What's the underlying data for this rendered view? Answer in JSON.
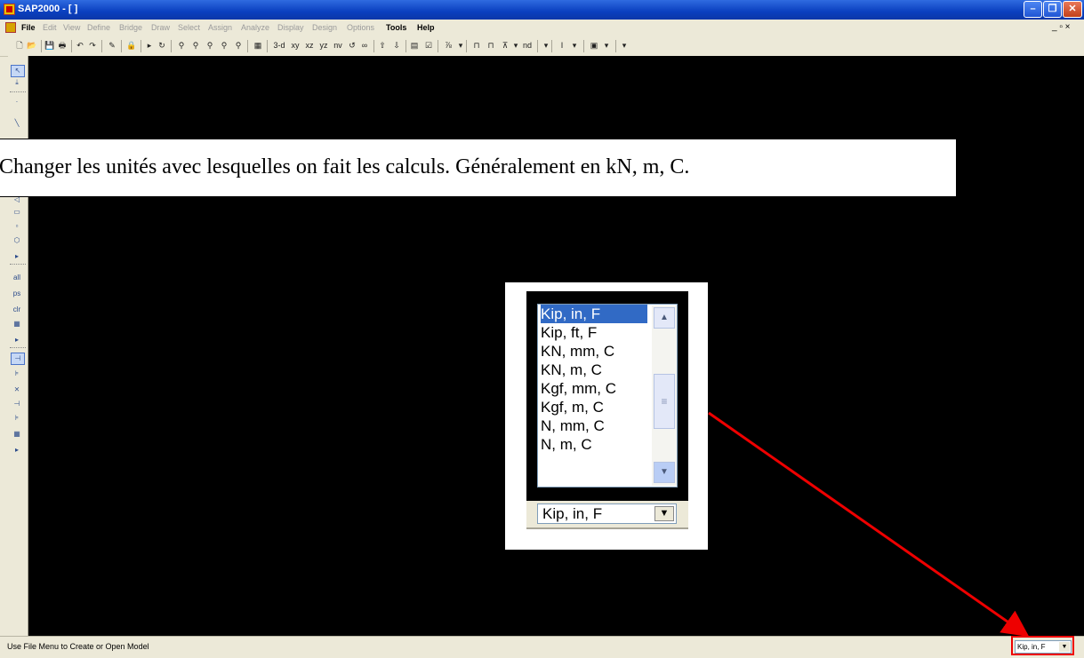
{
  "window": {
    "title": "SAP2000 - [ ]"
  },
  "menu": {
    "items": [
      "File",
      "Edit",
      "View",
      "Define",
      "Bridge",
      "Draw",
      "Select",
      "Assign",
      "Analyze",
      "Display",
      "Design",
      "Options",
      "Tools",
      "Help"
    ],
    "mdi_controls": "_ Ὕ7 ×"
  },
  "toolbar": {
    "view_3d": "3-d",
    "view_xy": "xy",
    "view_xz": "xz",
    "view_yz": "yz",
    "view_nv": "nv",
    "nd": "nd"
  },
  "left_toolbar": {
    "labels": [
      "all",
      "ps",
      "clr"
    ]
  },
  "callout": {
    "text": "Changer les unités avec lesquelles on fait les calculs. Généralement  en kN, m, C."
  },
  "units_dropdown": {
    "options": [
      "Kip, in, F",
      "Kip, ft, F",
      "KN, mm, C",
      "KN, m, C",
      "Kgf, mm, C",
      "Kgf, m, C",
      "N, mm, C",
      "N, m, C"
    ],
    "selected": "Kip, in, F"
  },
  "statusbar": {
    "message": "Use File Menu to Create or Open Model",
    "units": "Kip, in, F"
  },
  "colors": {
    "titlebar": "#0a3fbf",
    "highlight": "#316ac5",
    "annotation": "#e00000",
    "canvas": "#000000"
  }
}
